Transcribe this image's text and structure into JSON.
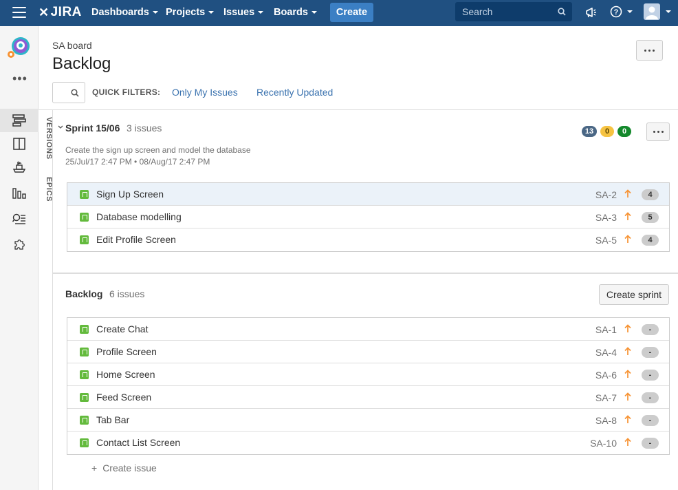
{
  "topnav": {
    "logo_text": "JIRA",
    "logo_mark": "✕",
    "menu": [
      "Dashboards",
      "Projects",
      "Issues",
      "Boards"
    ],
    "create_label": "Create",
    "search_placeholder": "Search",
    "icons": [
      "hamburger-icon",
      "search-icon",
      "megaphone-icon",
      "help-icon",
      "user-icon"
    ],
    "help_glyph": "?"
  },
  "sidebar": {
    "more_label": "•••",
    "items": [
      "backlog-icon",
      "board-icon",
      "releases-icon",
      "reports-icon",
      "issues-icon",
      "addons-icon"
    ],
    "active": "backlog-icon"
  },
  "vtabs": {
    "versions": "VERSIONS",
    "epics": "EPICS"
  },
  "header": {
    "board_name": "SA board",
    "title": "Backlog",
    "quick_filters_label": "QUICK FILTERS:",
    "filters": [
      "Only My Issues",
      "Recently Updated"
    ]
  },
  "sprint": {
    "name": "Sprint 15/06",
    "count": "3 issues",
    "goal": "Create the sign up screen and model the database",
    "dates": "25/Jul/17 2:47 PM  •  08/Aug/17 2:47 PM",
    "badges": [
      {
        "value": "13",
        "bg": "#4a6785",
        "color": "#ffffff"
      },
      {
        "value": "0",
        "bg": "#f6c342",
        "color": "#594300"
      },
      {
        "value": "0",
        "bg": "#14892c",
        "color": "#ffffff"
      }
    ],
    "issues": [
      {
        "summary": "Sign Up Screen",
        "key": "SA-2",
        "estimate": "4"
      },
      {
        "summary": "Database modelling",
        "key": "SA-3",
        "estimate": "5"
      },
      {
        "summary": "Edit Profile Screen",
        "key": "SA-5",
        "estimate": "4"
      }
    ]
  },
  "backlog": {
    "name": "Backlog",
    "count": "6 issues",
    "create_sprint_label": "Create sprint",
    "issues": [
      {
        "summary": "Create Chat",
        "key": "SA-1",
        "estimate": "-"
      },
      {
        "summary": "Profile Screen",
        "key": "SA-4",
        "estimate": "-"
      },
      {
        "summary": "Home Screen",
        "key": "SA-6",
        "estimate": "-"
      },
      {
        "summary": "Feed Screen",
        "key": "SA-7",
        "estimate": "-"
      },
      {
        "summary": "Tab Bar",
        "key": "SA-8",
        "estimate": "-"
      },
      {
        "summary": "Contact List Screen",
        "key": "SA-10",
        "estimate": "-"
      }
    ],
    "create_issue_plus": "+",
    "create_issue_label": "Create issue"
  },
  "colors": {
    "nav_bg": "#205081",
    "create_btn": "#3b7fc4",
    "story_icon": "#63ba3c",
    "priority_arrow": "#f79232",
    "link": "#3b73af"
  }
}
